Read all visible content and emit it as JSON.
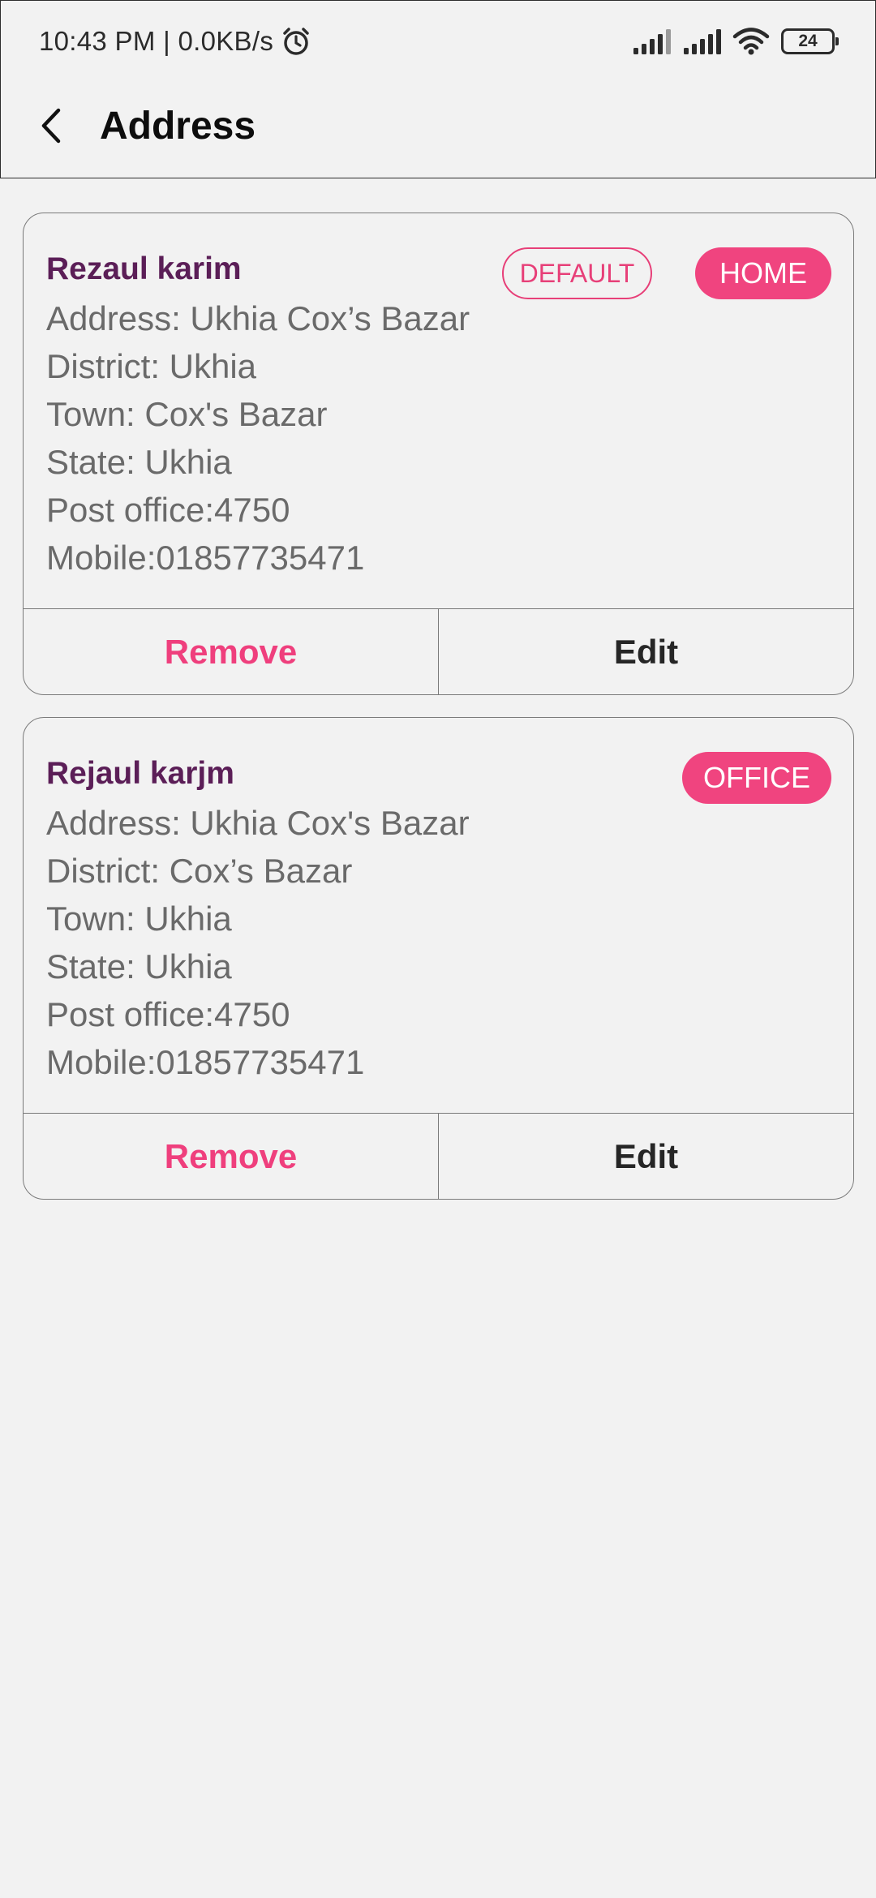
{
  "status_bar": {
    "time": "10:43 PM | 0.0KB/s",
    "battery": "24",
    "icons": [
      "alarm-icon",
      "signal-icon",
      "signal-icon",
      "wifi-icon",
      "battery-icon"
    ]
  },
  "header": {
    "title": "Address",
    "back_icon": "chevron-left-icon"
  },
  "addresses": [
    {
      "name": "Rezaul karim",
      "tags": [
        "DEFAULT",
        "HOME"
      ],
      "address": "Address: Ukhia Cox’s Bazar",
      "district": "District: Ukhia",
      "town": "Town: Cox's Bazar",
      "state": "State: Ukhia",
      "post_office": "Post office:4750",
      "mobile": "Mobile:01857735471",
      "remove_label": "Remove",
      "edit_label": "Edit"
    },
    {
      "name": "Rejaul karjm",
      "tags": [
        "OFFICE"
      ],
      "address": "Address: Ukhia Cox's Bazar",
      "district": "District: Cox’s Bazar",
      "town": "Town: Ukhia",
      "state": "State: Ukhia",
      "post_office": "Post office:4750",
      "mobile": "Mobile:01857735471",
      "remove_label": "Remove",
      "edit_label": "Edit"
    }
  ],
  "colors": {
    "accent": "#f0447f",
    "name": "#5b1e57",
    "text": "#6a6a6a",
    "background": "#f2f2f2"
  }
}
